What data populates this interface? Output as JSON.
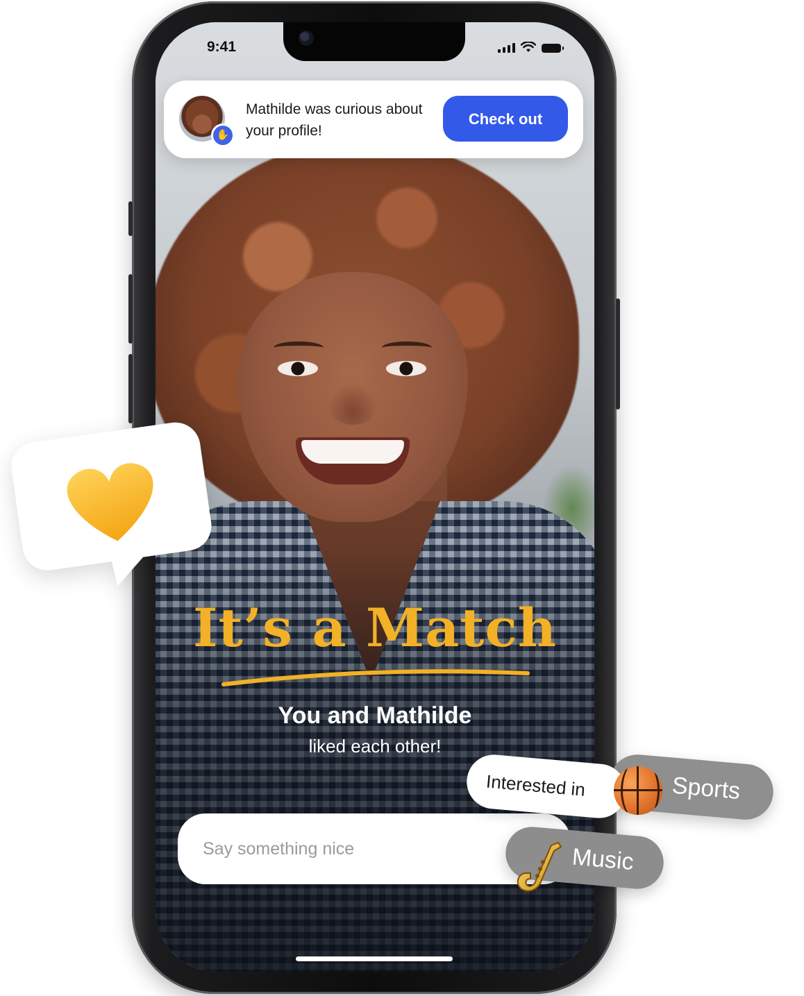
{
  "status_bar": {
    "time": "9:41"
  },
  "notification": {
    "message": "Mathilde was curious about your profile!",
    "button_label": "Check out",
    "badge_icon": "wave-hand-icon",
    "accent_color": "#3359e8"
  },
  "match": {
    "title": "It’s a Match",
    "subtitle": "You and Mathilde",
    "detail": "liked each other!",
    "title_color": "#f2b126"
  },
  "message_input": {
    "placeholder": "Say something nice"
  },
  "floating": {
    "heart_icon": "heart-icon",
    "interested_label": "Interested in",
    "interests": [
      {
        "label": "Sports",
        "icon": "basketball-icon"
      },
      {
        "label": "Music",
        "icon": "saxophone-icon"
      }
    ]
  }
}
